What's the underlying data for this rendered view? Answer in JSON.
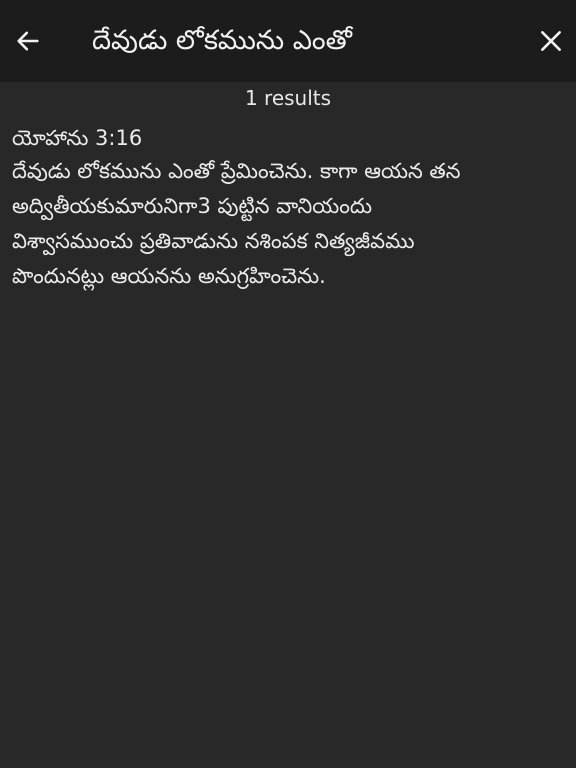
{
  "header": {
    "title": "దేవుడు లోకమును ఎంతో",
    "back_icon": "arrow-left-icon",
    "close_icon": "close-icon"
  },
  "results": {
    "count_label": "1 results",
    "items": [
      {
        "reference": "యోహాను 3:16",
        "text": "దేవుడు లోకమును ఎంతో ప్రేమించెను. కాగా ఆయన తన\nఅద్వితీయకుమారునిగా3 పుట్టిన వానియందు\nవిశ్వాసముంచు ప్రతివాడును నశింపక నిత్యజీవము\nపొందునట్లు ఆయనను అనుగ్రహించెను."
      }
    ]
  },
  "colors": {
    "background": "#282828",
    "topbar": "#1c1c1c",
    "text": "#ececec"
  }
}
